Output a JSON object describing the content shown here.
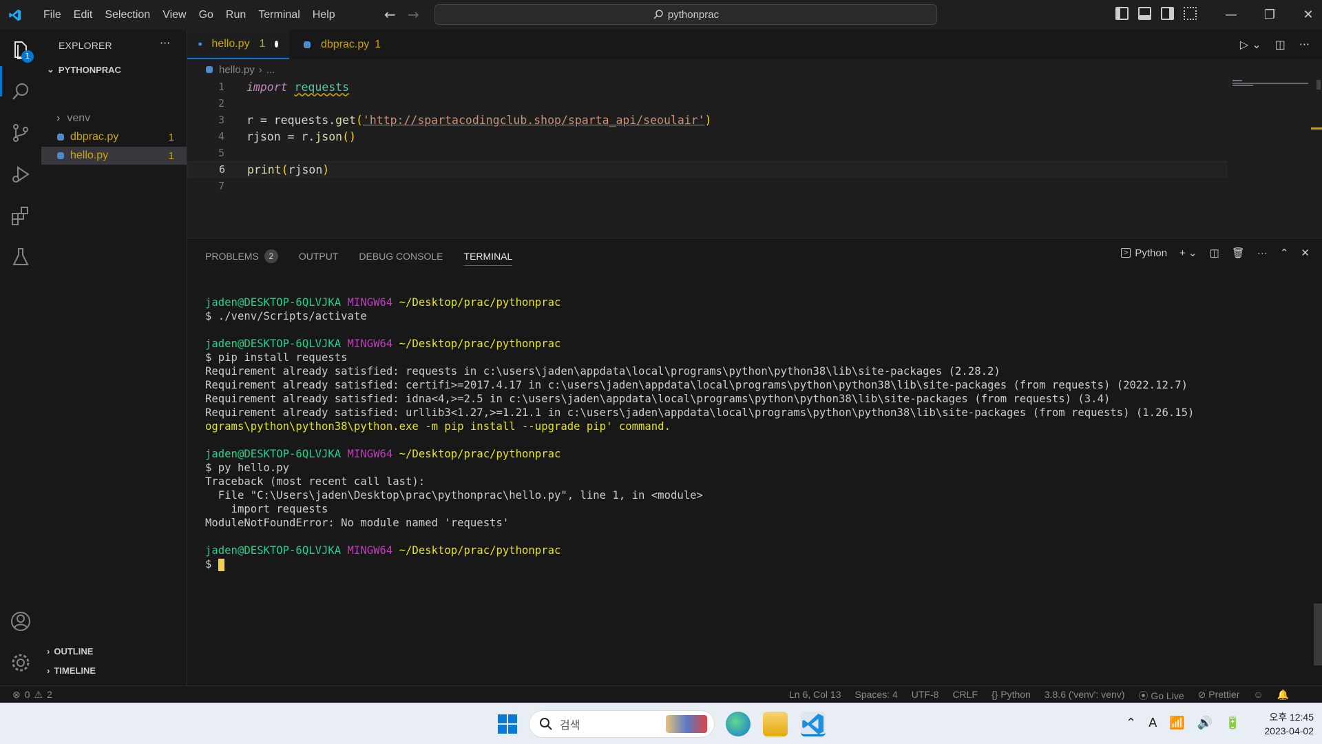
{
  "menu": [
    "File",
    "Edit",
    "Selection",
    "View",
    "Go",
    "Run",
    "Terminal",
    "Help"
  ],
  "command_center": {
    "text": "pythonprac"
  },
  "explorer": {
    "title": "EXPLORER",
    "more": "···",
    "project": "PYTHONPRAC",
    "items": [
      {
        "label": "venv",
        "kind": "folder"
      },
      {
        "label": "dbprac.py",
        "count": "1"
      },
      {
        "label": "hello.py",
        "count": "1"
      }
    ],
    "outline": "OUTLINE",
    "timeline": "TIMELINE"
  },
  "activity_badge": "1",
  "tabs": [
    {
      "label": "hello.py",
      "count": "1"
    },
    {
      "label": "dbprac.py",
      "count": "1"
    }
  ],
  "breadcrumb": {
    "file": "hello.py",
    "rest": "..."
  },
  "code": {
    "line_numbers": [
      "1",
      "2",
      "3",
      "4",
      "5",
      "6",
      "7"
    ],
    "l1_kw": "import",
    "l1_mod": "requests",
    "l3_a": "r = requests.",
    "l3_fn": "get",
    "l3_paren_open": "(",
    "l3_str": "'http://spartacodingclub.shop/sparta_api/seoulair'",
    "l3_paren_close": ")",
    "l4_a": "rjson = r.",
    "l4_fn": "json",
    "l4_paren": "()",
    "l6_fn": "print",
    "l6_open": "(",
    "l6_arg": "rjson",
    "l6_close": ")"
  },
  "panel": {
    "tabs": [
      "PROBLEMS",
      "OUTPUT",
      "DEBUG CONSOLE",
      "TERMINAL"
    ],
    "problems_count": "2",
    "terminal_kind": "Python"
  },
  "terminal": {
    "user": "jaden@DESKTOP-6QLVJKA",
    "host": "MINGW64",
    "path": "~/Desktop/prac/pythonprac",
    "cmd1": "$ ./venv/Scripts/activate",
    "cmd2": "$ pip install requests",
    "req1": "Requirement already satisfied: requests in c:\\users\\jaden\\appdata\\local\\programs\\python\\python38\\lib\\site-packages (2.28.2)",
    "req2": "Requirement already satisfied: certifi>=2017.4.17 in c:\\users\\jaden\\appdata\\local\\programs\\python\\python38\\lib\\site-packages (from requests) (2022.12.7)",
    "req3": "Requirement already satisfied: idna<4,>=2.5 in c:\\users\\jaden\\appdata\\local\\programs\\python\\python38\\lib\\site-packages (from requests) (3.4)",
    "req4": "Requirement already satisfied: urllib3<1.27,>=1.21.1 in c:\\users\\jaden\\appdata\\local\\programs\\python\\python38\\lib\\site-packages (from requests) (1.26.15)",
    "warn": "ograms\\python\\python38\\python.exe -m pip install --upgrade pip' command.",
    "cmd3": "$ py hello.py",
    "tb1": "Traceback (most recent call last):",
    "tb2": "  File \"C:\\Users\\jaden\\Desktop\\prac\\pythonprac\\hello.py\", line 1, in <module>",
    "tb3": "    import requests",
    "tb4": "ModuleNotFoundError: No module named 'requests'",
    "prompt": "$ "
  },
  "statusbar": {
    "errors": "0",
    "warnings": "2",
    "position": "Ln 6, Col 13",
    "spaces": "Spaces: 4",
    "encoding": "UTF-8",
    "eol": "CRLF",
    "language": "Python",
    "interpreter": "3.8.6 ('venv': venv)",
    "golive": "Go Live",
    "prettier": "Prettier"
  },
  "taskbar": {
    "search_placeholder": "검색",
    "time": "오후 12:45",
    "date": "2023-04-02"
  },
  "colors": {
    "accent": "#0078d4",
    "warning": "#cca700",
    "term_user": "#23d18b",
    "term_host": "#bc3fbc",
    "term_path": "#e5e510"
  }
}
